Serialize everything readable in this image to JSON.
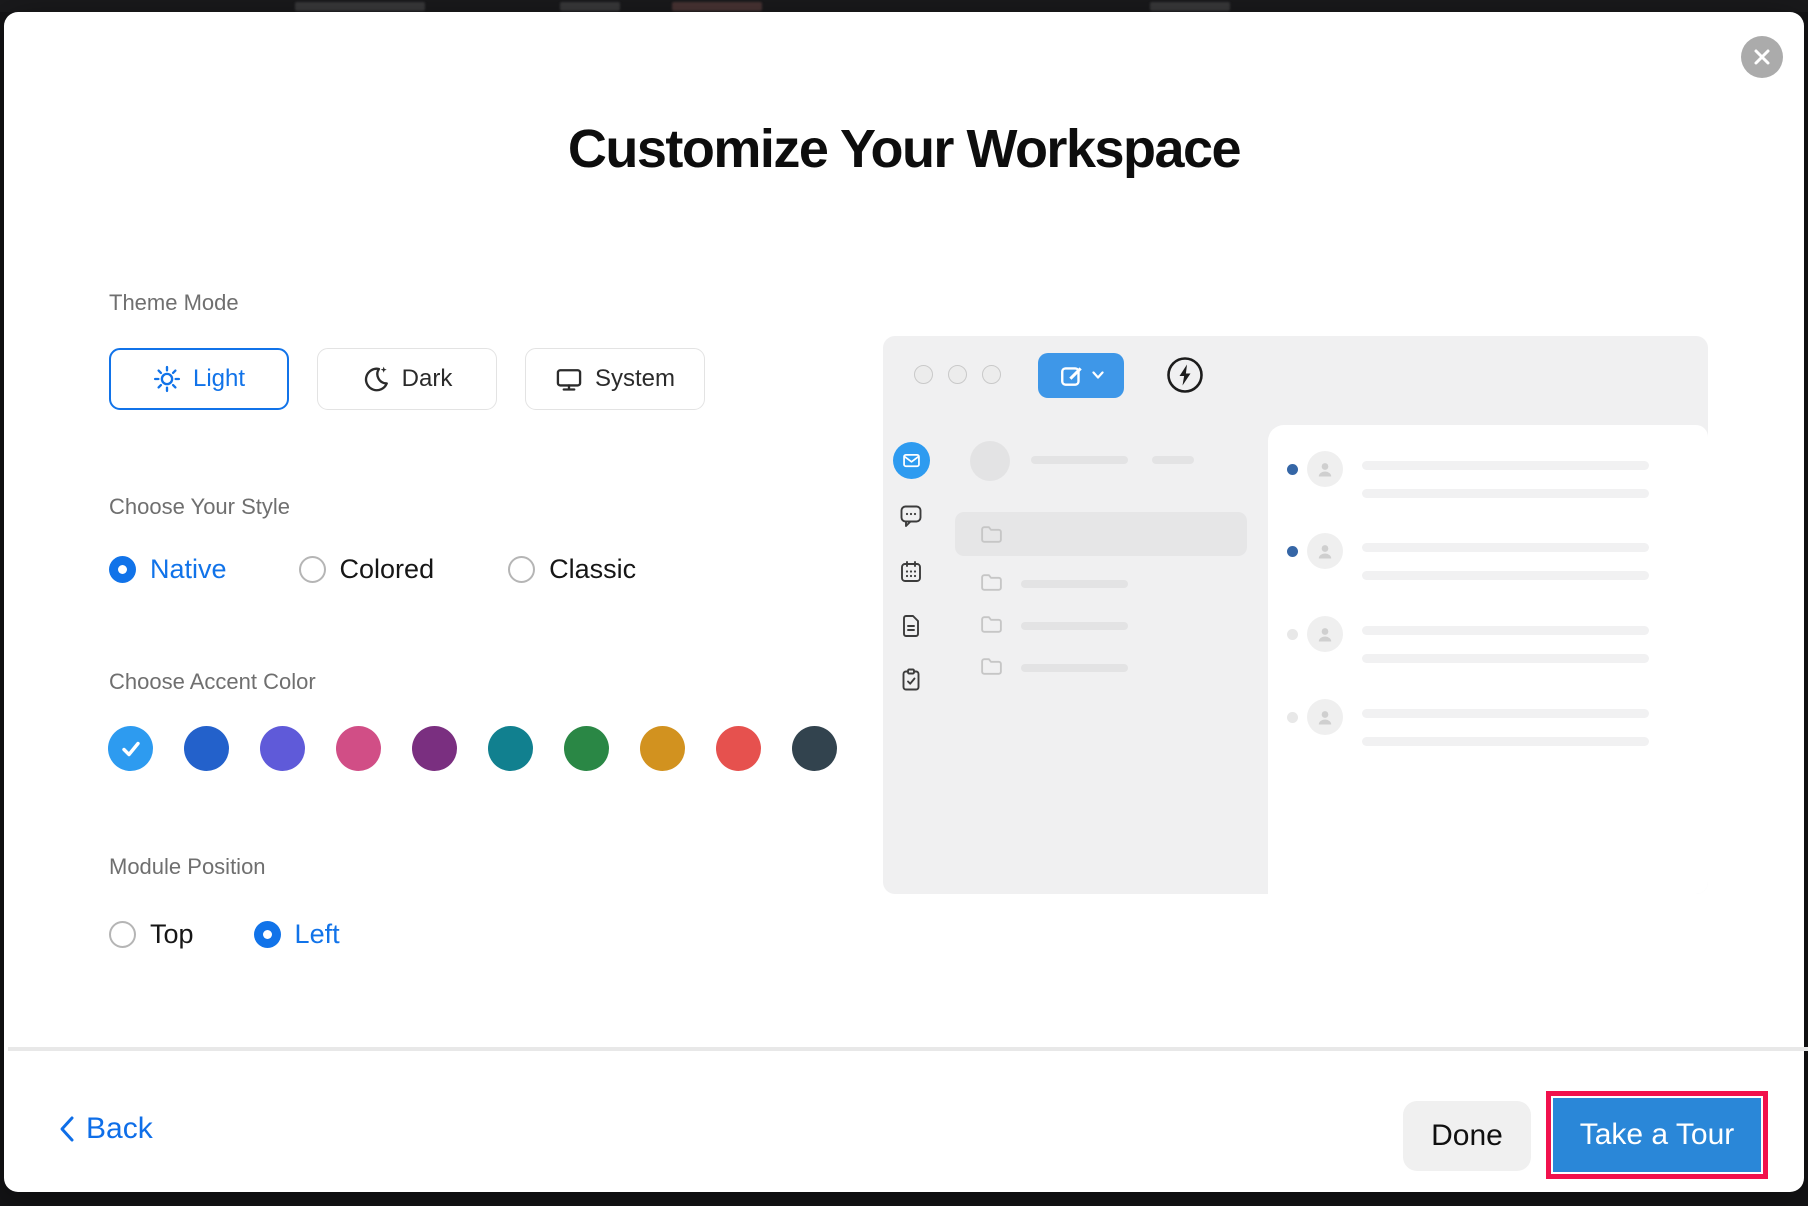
{
  "modal": {
    "title": "Customize Your Workspace",
    "close_icon": "close-icon"
  },
  "theme_mode": {
    "label": "Theme Mode",
    "options": [
      {
        "label": "Light",
        "icon": "sun-icon",
        "selected": true
      },
      {
        "label": "Dark",
        "icon": "moon-stars-icon",
        "selected": false
      },
      {
        "label": "System",
        "icon": "monitor-icon",
        "selected": false
      }
    ]
  },
  "style_section": {
    "label": "Choose Your Style",
    "options": [
      {
        "label": "Native",
        "selected": true
      },
      {
        "label": "Colored",
        "selected": false
      },
      {
        "label": "Classic",
        "selected": false
      }
    ]
  },
  "accent_section": {
    "label": "Choose Accent Color",
    "selected_index": 0,
    "colors": [
      "#2d9bf0",
      "#2361cb",
      "#5f5ad9",
      "#d14e86",
      "#7a2f80",
      "#11808f",
      "#2a8745",
      "#d2921f",
      "#e6514e",
      "#32434e"
    ]
  },
  "module_position": {
    "label": "Module Position",
    "options": [
      {
        "label": "Top",
        "selected": false
      },
      {
        "label": "Left",
        "selected": true
      }
    ]
  },
  "footer": {
    "back_label": "Back",
    "done_label": "Done",
    "tour_label": "Take a Tour"
  },
  "ui_colors": {
    "accent_blue": "#1173e9",
    "tour_button_blue": "#2a87d8",
    "annotation_red": "#f1114d",
    "compose_blue": "#3e97e8",
    "unread_dot_blue": "#3566a6"
  }
}
